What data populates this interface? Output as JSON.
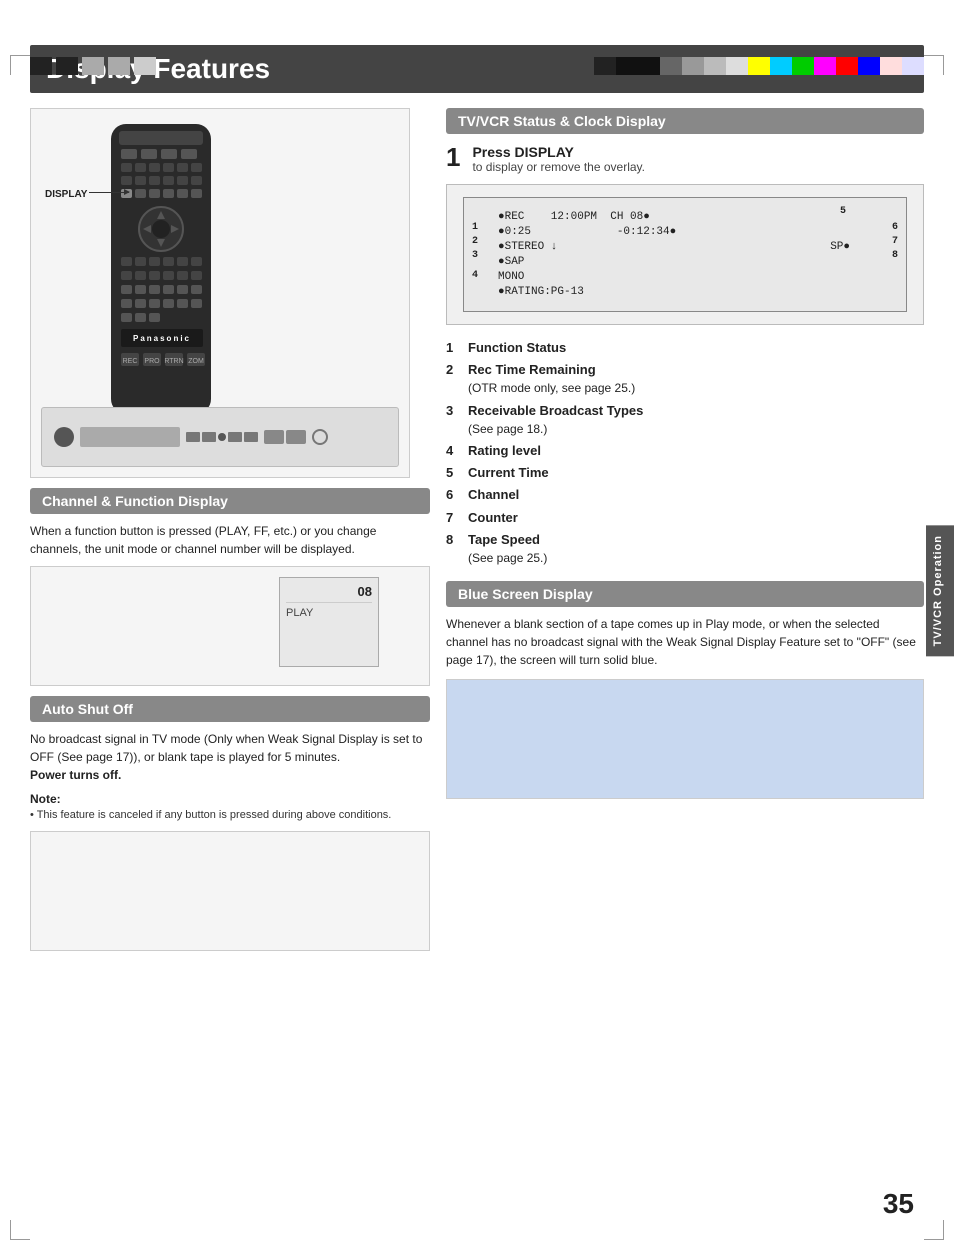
{
  "page": {
    "number": "35",
    "title": "Display Features"
  },
  "side_tab": {
    "label": "TV/VCR Operation"
  },
  "device_label": "DISPLAY",
  "sections": {
    "tvvcr": {
      "header": "TV/VCR Status & Clock Display",
      "step1": {
        "number": "1",
        "title": "Press DISPLAY",
        "subtitle": "to display or remove the overlay."
      },
      "status_display": {
        "callout5": "5",
        "callout6": "6",
        "callout7": "7",
        "callout8": "8",
        "callout1": "1",
        "callout2": "2",
        "callout3": "3",
        "callout4": "4",
        "line1_label": "1",
        "line1_content": "●REC    12:00PM  CH 08●",
        "line2_label": "2",
        "line2_content": "●0:25             -0:12:34●",
        "line3_label": "3",
        "line3_content": "●STEREO ↓",
        "line3b": "●SAP",
        "line3c": " MONO",
        "line4_label": "4",
        "line4_content": "●RATING:PG-13",
        "sp_label": "SP●"
      },
      "features": [
        {
          "num": "1",
          "label": "Function Status",
          "sub": ""
        },
        {
          "num": "2",
          "label": "Rec Time Remaining",
          "sub": "(OTR mode only, see page 25.)"
        },
        {
          "num": "3",
          "label": "Receivable Broadcast Types",
          "sub": "(See page 18.)"
        },
        {
          "num": "4",
          "label": "Rating level",
          "sub": ""
        },
        {
          "num": "5",
          "label": "Current Time",
          "sub": ""
        },
        {
          "num": "6",
          "label": "Channel",
          "sub": ""
        },
        {
          "num": "7",
          "label": "Counter",
          "sub": ""
        },
        {
          "num": "8",
          "label": "Tape Speed",
          "sub": "(See page 25.)"
        }
      ]
    },
    "channel": {
      "header": "Channel & Function Display",
      "text": "When a function button is pressed (PLAY, FF, etc.) or you change channels, the unit mode or channel number will be displayed.",
      "channel_num": "08",
      "play_text": "PLAY"
    },
    "autoshutoff": {
      "header": "Auto Shut Off",
      "text": "No broadcast signal in TV mode (Only when Weak Signal Display is set to OFF (See page 17)), or blank tape is played for 5 minutes.",
      "bold_text": "Power turns off.",
      "note_label": "Note:",
      "note_text": "• This feature is canceled if any button is pressed during above conditions."
    },
    "bluescreen": {
      "header": "Blue Screen Display",
      "text": "Whenever a blank section of a tape comes up in Play mode, or when the selected channel has no broadcast signal with the Weak Signal Display Feature set to \"OFF\" (see page 17), the screen will turn solid blue."
    }
  }
}
